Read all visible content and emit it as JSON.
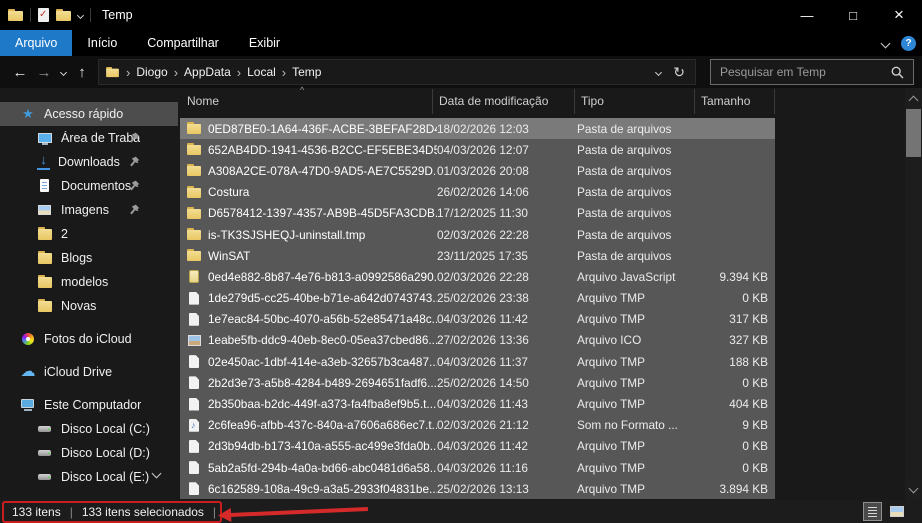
{
  "window": {
    "title": "Temp"
  },
  "icons": {
    "back": "←",
    "forward": "→",
    "up": "↑",
    "minimize": "—",
    "maximize": "□",
    "close": "×",
    "help": "?",
    "refresh": "↻",
    "check": "✓",
    "sort_asc": "^",
    "pipe": "|",
    "crumb_sep": "›"
  },
  "icon_glyphs": {
    "star": "★",
    "icloud-drive": "☁",
    "download": "↓"
  },
  "colors": {
    "accent_blue": "#1e7ac9",
    "selection_gray": "#575757",
    "annotation_red": "#c81e1e",
    "folder_yellow": "#e9c763"
  },
  "ribbon": {
    "tabs": [
      {
        "id": "arquivo",
        "label": "Arquivo",
        "active": true
      },
      {
        "id": "inicio",
        "label": "Início",
        "active": false
      },
      {
        "id": "compartilhar",
        "label": "Compartilhar",
        "active": false
      },
      {
        "id": "exibir",
        "label": "Exibir",
        "active": false
      }
    ]
  },
  "address": {
    "crumbs": [
      "Diogo",
      "AppData",
      "Local",
      "Temp"
    ],
    "search_placeholder": "Pesquisar em Temp"
  },
  "sidebar": {
    "items": [
      {
        "id": "acesso-rapido",
        "label": "Acesso rápido",
        "icon": "star",
        "level": 0,
        "selected": true,
        "pinned": false,
        "gap": false
      },
      {
        "id": "area-de-trabalho",
        "label": "Área de Traba",
        "icon": "desktop",
        "level": 1,
        "selected": false,
        "pinned": true,
        "gap": false
      },
      {
        "id": "downloads",
        "label": "Downloads",
        "icon": "download",
        "level": 1,
        "selected": false,
        "pinned": true,
        "gap": false
      },
      {
        "id": "documentos",
        "label": "Documentos",
        "icon": "document",
        "level": 1,
        "selected": false,
        "pinned": true,
        "gap": false
      },
      {
        "id": "imagens",
        "label": "Imagens",
        "icon": "image",
        "level": 1,
        "selected": false,
        "pinned": true,
        "gap": false
      },
      {
        "id": "2",
        "label": "2",
        "icon": "folder",
        "level": 1,
        "selected": false,
        "pinned": false,
        "gap": false
      },
      {
        "id": "blogs",
        "label": "Blogs",
        "icon": "folder",
        "level": 1,
        "selected": false,
        "pinned": false,
        "gap": false
      },
      {
        "id": "modelos",
        "label": "modelos",
        "icon": "folder",
        "level": 1,
        "selected": false,
        "pinned": false,
        "gap": false
      },
      {
        "id": "novas",
        "label": "Novas",
        "icon": "folder",
        "level": 1,
        "selected": false,
        "pinned": false,
        "gap": false
      },
      {
        "id": "fotos-do-icloud",
        "label": "Fotos do iCloud",
        "icon": "icloud-photos",
        "level": 0,
        "selected": false,
        "pinned": false,
        "gap": true
      },
      {
        "id": "icloud-drive",
        "label": "iCloud Drive",
        "icon": "icloud-drive",
        "level": 0,
        "selected": false,
        "pinned": false,
        "gap": true
      },
      {
        "id": "este-computador",
        "label": "Este Computador",
        "icon": "computer",
        "level": 0,
        "selected": false,
        "pinned": false,
        "gap": true
      },
      {
        "id": "disco-local-c",
        "label": "Disco Local (C:)",
        "icon": "drive",
        "level": 1,
        "selected": false,
        "pinned": false,
        "gap": false
      },
      {
        "id": "disco-local-d",
        "label": "Disco Local (D:)",
        "icon": "drive",
        "level": 1,
        "selected": false,
        "pinned": false,
        "gap": false
      },
      {
        "id": "disco-local-e",
        "label": "Disco Local (E:)",
        "icon": "drive",
        "level": 1,
        "selected": false,
        "pinned": false,
        "gap": false
      }
    ]
  },
  "list": {
    "columns": [
      {
        "label": "Nome",
        "sorted": "asc"
      },
      {
        "label": "Data de modificação"
      },
      {
        "label": "Tipo"
      },
      {
        "label": "Tamanho"
      }
    ],
    "rows": [
      {
        "name": "0ED87BE0-1A64-436F-ACBE-3BEFAF28D4...",
        "date": "18/02/2026 12:03",
        "type": "Pasta de arquivos",
        "size": "",
        "icon": "folder",
        "focused": true
      },
      {
        "name": "652AB4DD-1941-4536-B2CC-EF5EBE34D5...",
        "date": "04/03/2026 12:07",
        "type": "Pasta de arquivos",
        "size": "",
        "icon": "folder"
      },
      {
        "name": "A308A2CE-078A-47D0-9AD5-AE7C5529D...",
        "date": "01/03/2026 20:08",
        "type": "Pasta de arquivos",
        "size": "",
        "icon": "folder"
      },
      {
        "name": "Costura",
        "date": "26/02/2026 14:06",
        "type": "Pasta de arquivos",
        "size": "",
        "icon": "folder"
      },
      {
        "name": "D6578412-1397-4357-AB9B-45D5FA3CDB...",
        "date": "17/12/2025 11:30",
        "type": "Pasta de arquivos",
        "size": "",
        "icon": "folder"
      },
      {
        "name": "is-TK3SJSHEQJ-uninstall.tmp",
        "date": "02/03/2026 22:28",
        "type": "Pasta de arquivos",
        "size": "",
        "icon": "folder"
      },
      {
        "name": "WinSAT",
        "date": "23/11/2025 17:35",
        "type": "Pasta de arquivos",
        "size": "",
        "icon": "folder"
      },
      {
        "name": "0ed4e882-8b87-4e76-b813-a0992586a290...",
        "date": "02/03/2026 22:28",
        "type": "Arquivo JavaScript",
        "size": "9.394 KB",
        "icon": "js"
      },
      {
        "name": "1de279d5-cc25-40be-b71e-a642d0743743...",
        "date": "25/02/2026 23:38",
        "type": "Arquivo TMP",
        "size": "0 KB",
        "icon": "file"
      },
      {
        "name": "1e7eac84-50bc-4070-a56b-52e85471a48c....",
        "date": "04/03/2026 11:42",
        "type": "Arquivo TMP",
        "size": "317 KB",
        "icon": "file"
      },
      {
        "name": "1eabe5fb-ddc9-40eb-8ec0-05ea37cbed86...",
        "date": "27/02/2026 13:36",
        "type": "Arquivo ICO",
        "size": "327 KB",
        "icon": "ico"
      },
      {
        "name": "02e450ac-1dbf-414e-a3eb-32657b3ca487....",
        "date": "04/03/2026 11:37",
        "type": "Arquivo TMP",
        "size": "188 KB",
        "icon": "file"
      },
      {
        "name": "2b2d3e73-a5b8-4284-b489-2694651fadf6....",
        "date": "25/02/2026 14:50",
        "type": "Arquivo TMP",
        "size": "0 KB",
        "icon": "file"
      },
      {
        "name": "2b350baa-b2dc-449f-a373-fa4fba8ef9b5.t...",
        "date": "04/03/2026 11:43",
        "type": "Arquivo TMP",
        "size": "404 KB",
        "icon": "file"
      },
      {
        "name": "2c6fea96-afbb-437c-840a-a7606a686ec7.t...",
        "date": "02/03/2026 21:12",
        "type": "Som no Formato ...",
        "size": "9 KB",
        "icon": "audio"
      },
      {
        "name": "2d3b94db-b173-410a-a555-ac499e3fda0b...",
        "date": "04/03/2026 11:42",
        "type": "Arquivo TMP",
        "size": "0 KB",
        "icon": "file"
      },
      {
        "name": "5ab2a5fd-294b-4a0a-bd66-abc0481d6a58...",
        "date": "04/03/2026 11:16",
        "type": "Arquivo TMP",
        "size": "0 KB",
        "icon": "file"
      },
      {
        "name": "6c162589-108a-49c9-a3a5-2933f04831be....",
        "date": "25/02/2026 13:13",
        "type": "Arquivo TMP",
        "size": "3.894 KB",
        "icon": "file"
      }
    ]
  },
  "status": {
    "segments": [
      "133 itens",
      "133 itens selecionados"
    ]
  }
}
